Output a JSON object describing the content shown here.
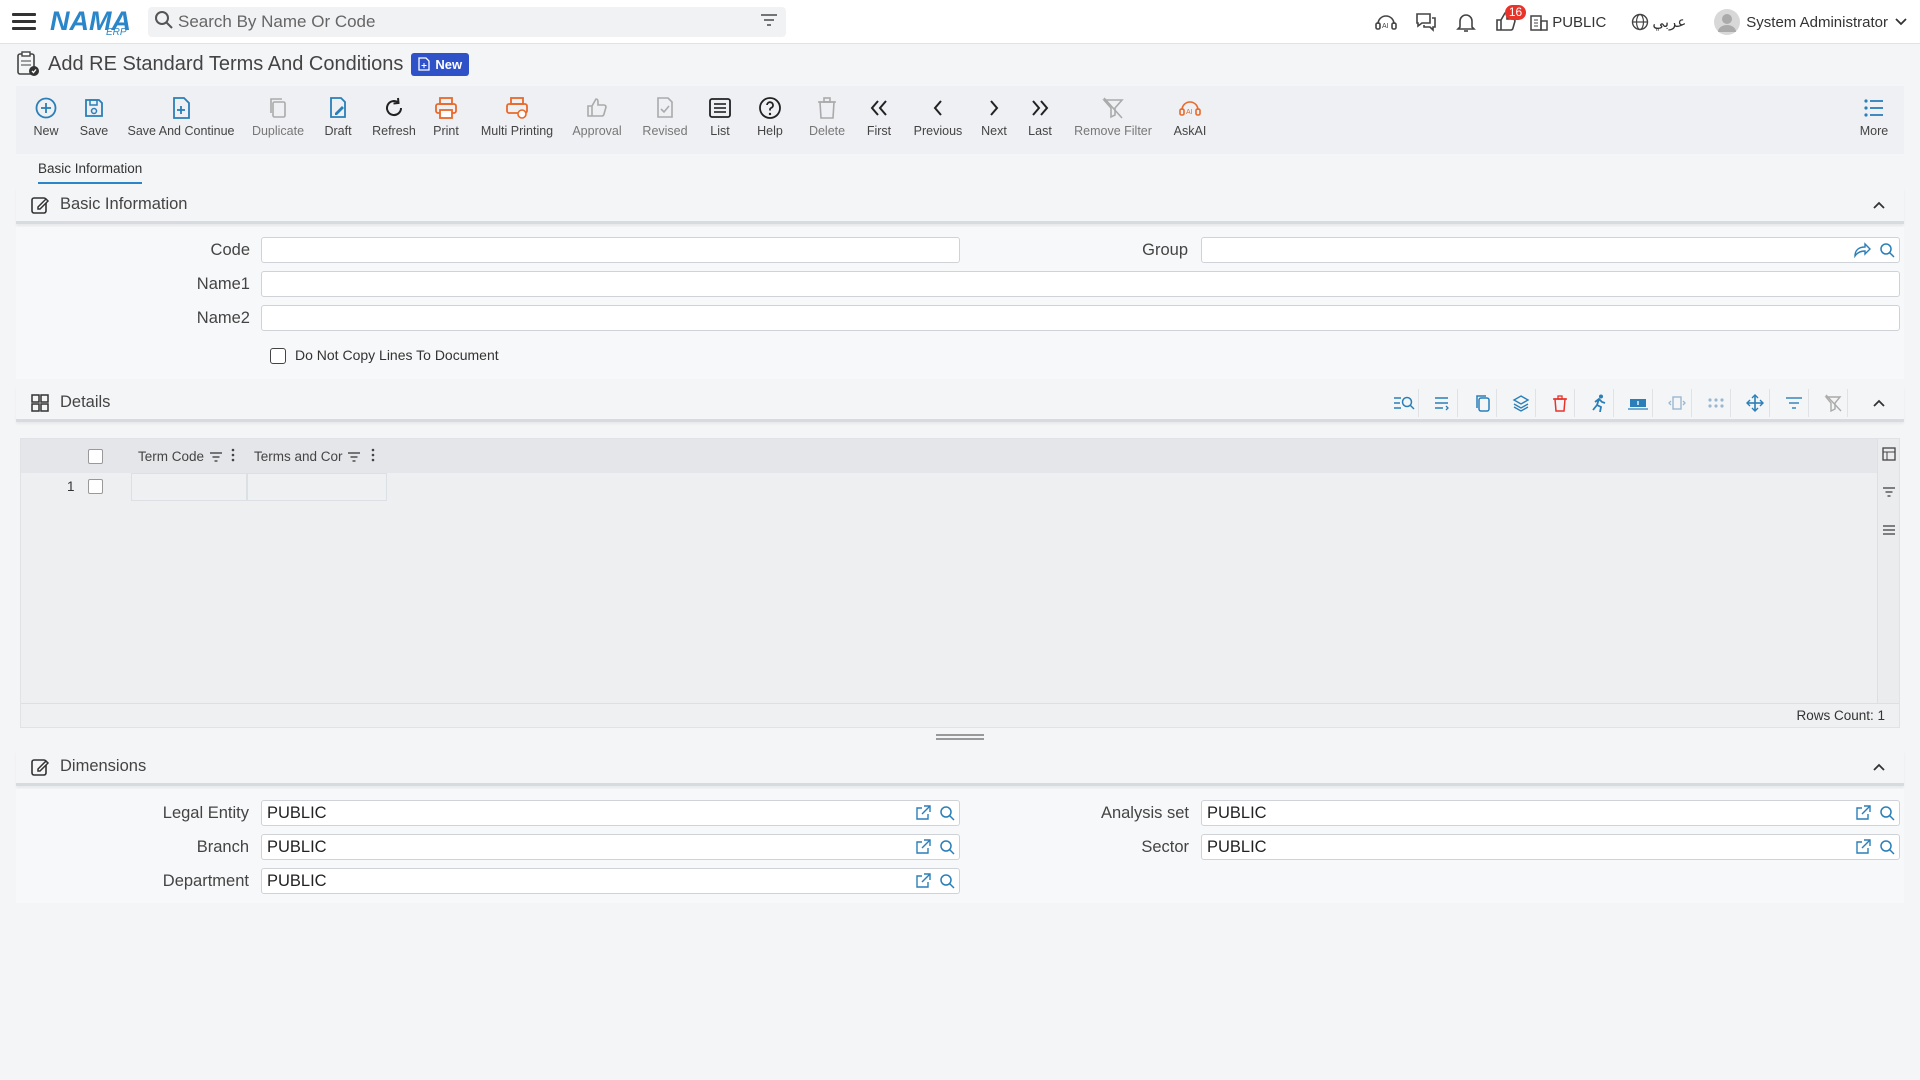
{
  "header": {
    "logo_text": "NAMA",
    "logo_sub": "ERP",
    "search_placeholder": "Search By Name Or Code",
    "notifications_badge": "16",
    "company": "PUBLIC",
    "language": "عربي",
    "user": "System Administrator"
  },
  "page": {
    "title": "Add RE Standard Terms And Conditions",
    "status_badge": "New"
  },
  "toolbar": {
    "new": "New",
    "save": "Save",
    "save_continue": "Save And Continue",
    "duplicate": "Duplicate",
    "draft": "Draft",
    "refresh": "Refresh",
    "print": "Print",
    "multi_printing": "Multi Printing",
    "approval": "Approval",
    "revised": "Revised",
    "list": "List",
    "help": "Help",
    "delete": "Delete",
    "first": "First",
    "previous": "Previous",
    "next": "Next",
    "last": "Last",
    "remove_filter": "Remove Filter",
    "askai": "AskAI",
    "more": "More"
  },
  "tabs": [
    "Basic Information"
  ],
  "basic": {
    "title": "Basic Information",
    "code_label": "Code",
    "code_value": "",
    "group_label": "Group",
    "group_value": "",
    "name1_label": "Name1",
    "name1_value": "",
    "name2_label": "Name2",
    "name2_value": "",
    "checkbox_label": "Do Not Copy Lines To Document"
  },
  "details": {
    "title": "Details",
    "columns": [
      "Term Code",
      "Terms and Cor"
    ],
    "rows": [
      {
        "num": "1",
        "term_code": "",
        "terms": ""
      }
    ],
    "rows_count": "Rows Count: 1"
  },
  "dimensions": {
    "title": "Dimensions",
    "legal_entity_label": "Legal Entity",
    "legal_entity_value": "PUBLIC",
    "branch_label": "Branch",
    "branch_value": "PUBLIC",
    "department_label": "Department",
    "department_value": "PUBLIC",
    "analysis_set_label": "Analysis set",
    "analysis_set_value": "PUBLIC",
    "sector_label": "Sector",
    "sector_value": "PUBLIC"
  },
  "colors": {
    "brand": "#2a86c8",
    "badge_blue": "#2f52c9",
    "orange": "#e8692a",
    "notification_red": "#e8332b",
    "icon_blue": "#2a7fb8"
  }
}
